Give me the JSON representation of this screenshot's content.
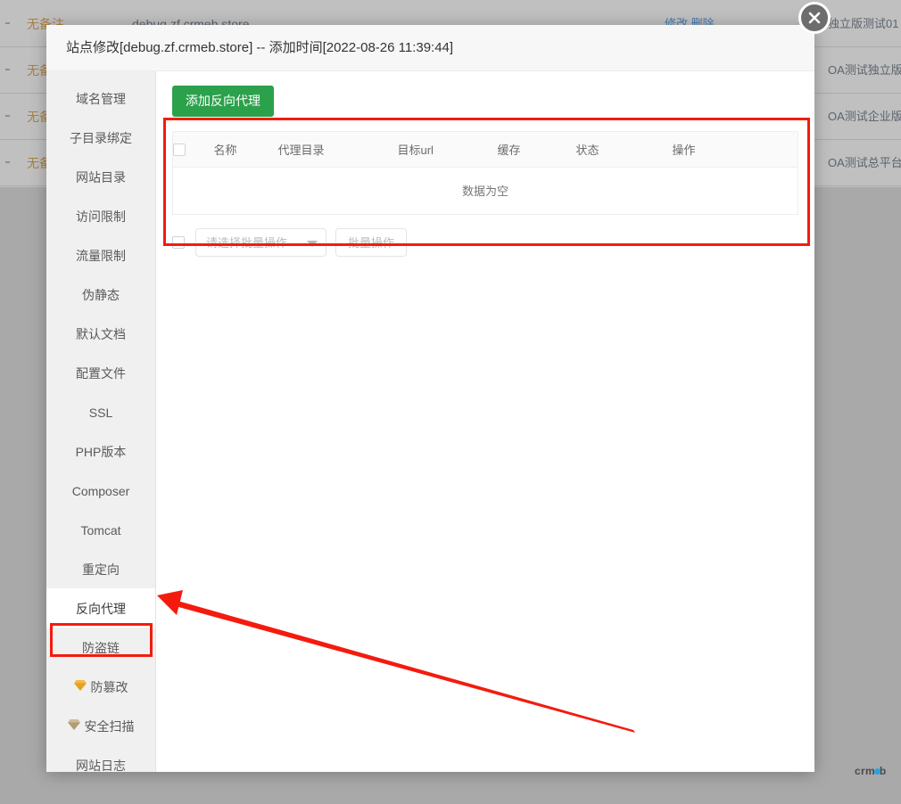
{
  "background": {
    "rows": [
      {
        "status": "无备注",
        "middle": "debug.zf.crmeb.store",
        "ops": "修改  删除",
        "right": "独立版测试01"
      },
      {
        "status": "无备注",
        "middle": "",
        "ops": "",
        "right": "OA测试独立版"
      },
      {
        "status": "无备注",
        "middle": "",
        "ops": "",
        "right": "OA测试企业版"
      },
      {
        "status": "无备注",
        "middle": "",
        "ops": "",
        "right": "OA测试总平台"
      }
    ]
  },
  "dialog": {
    "title": "站点修改[debug.zf.crmeb.store] -- 添加时间[2022-08-26 11:39:44]",
    "close_icon": "close-icon"
  },
  "sidebar": {
    "items": [
      {
        "label": "域名管理",
        "icon": null,
        "active": false
      },
      {
        "label": "子目录绑定",
        "icon": null,
        "active": false
      },
      {
        "label": "网站目录",
        "icon": null,
        "active": false
      },
      {
        "label": "访问限制",
        "icon": null,
        "active": false
      },
      {
        "label": "流量限制",
        "icon": null,
        "active": false
      },
      {
        "label": "伪静态",
        "icon": null,
        "active": false
      },
      {
        "label": "默认文档",
        "icon": null,
        "active": false
      },
      {
        "label": "配置文件",
        "icon": null,
        "active": false
      },
      {
        "label": "SSL",
        "icon": null,
        "active": false
      },
      {
        "label": "PHP版本",
        "icon": null,
        "active": false
      },
      {
        "label": "Composer",
        "icon": null,
        "active": false
      },
      {
        "label": "Tomcat",
        "icon": null,
        "active": false
      },
      {
        "label": "重定向",
        "icon": null,
        "active": false
      },
      {
        "label": "反向代理",
        "icon": null,
        "active": true
      },
      {
        "label": "防盗链",
        "icon": null,
        "active": false
      },
      {
        "label": "防篡改",
        "icon": "diamond-gold-icon",
        "active": false
      },
      {
        "label": "安全扫描",
        "icon": "diamond-silver-icon",
        "active": false
      },
      {
        "label": "网站日志",
        "icon": null,
        "active": false
      }
    ]
  },
  "content": {
    "add_button_label": "添加反向代理",
    "table": {
      "columns": [
        "名称",
        "代理目录",
        "目标url",
        "缓存",
        "状态",
        "操作"
      ],
      "rows": [],
      "empty_text": "数据为空"
    },
    "batch": {
      "select_placeholder": "请选择批量操作",
      "action_label": "批量操作"
    }
  },
  "annotations": {
    "table_highlight_color": "#f41b0e",
    "sidebar_highlight_color": "#f41b0e",
    "arrow_color": "#f41b0e"
  },
  "watermark": {
    "prefix": "crm",
    "suffix": "b"
  },
  "colors": {
    "primary_green": "#2ca14b",
    "annotation_red": "#f41b0e",
    "dialog_bg": "#ffffff",
    "sidebar_bg": "#f0f0f0",
    "header_bg": "#f7f7f7",
    "watermark_blue": "#29a3e0"
  }
}
